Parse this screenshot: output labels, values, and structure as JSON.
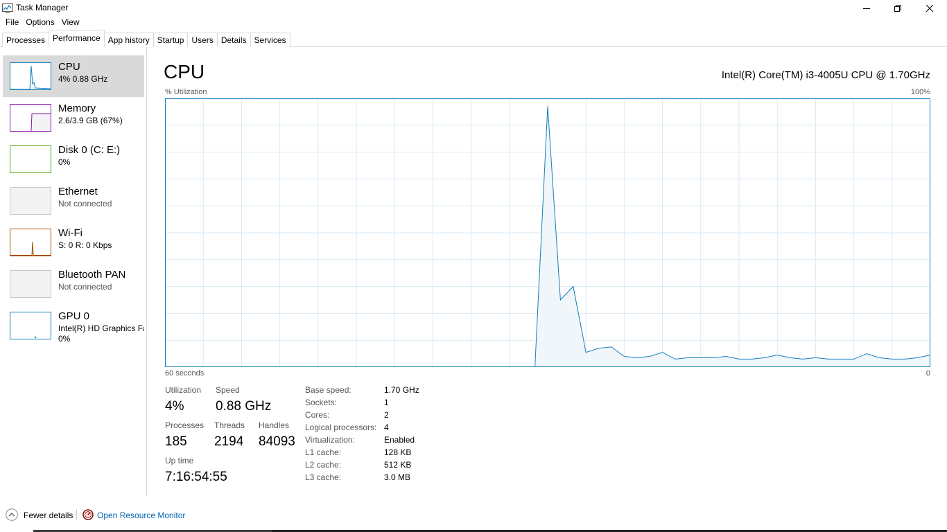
{
  "window": {
    "title": "Task Manager",
    "icon": "task-manager-icon",
    "controls": [
      "minimize-icon",
      "restore-icon",
      "close-icon"
    ]
  },
  "menu": {
    "file": "File",
    "options": "Options",
    "view": "View"
  },
  "tabs": [
    {
      "label": "Processes",
      "active": false
    },
    {
      "label": "Performance",
      "active": true
    },
    {
      "label": "App history",
      "active": false
    },
    {
      "label": "Startup",
      "active": false
    },
    {
      "label": "Users",
      "active": false
    },
    {
      "label": "Details",
      "active": false
    },
    {
      "label": "Services",
      "active": false
    }
  ],
  "sidebar": {
    "items": [
      {
        "name": "CPU",
        "sub": "4%  0.88 GHz",
        "color": "#117dbb",
        "selected": true
      },
      {
        "name": "Memory",
        "sub": "2.6/3.9 GB (67%)",
        "color": "#8b12ae",
        "selected": false
      },
      {
        "name": "Disk 0 (C: E:)",
        "sub": "0%",
        "color": "#4da60c",
        "selected": false
      },
      {
        "name": "Ethernet",
        "sub": "Not connected",
        "color": "#c7c7c7",
        "selected": false
      },
      {
        "name": "Wi-Fi",
        "sub": "S: 0  R: 0 Kbps",
        "color": "#a74f01",
        "selected": false
      },
      {
        "name": "Bluetooth PAN",
        "sub": "Not connected",
        "color": "#c7c7c7",
        "selected": false
      },
      {
        "name": "GPU 0",
        "sub": "Intel(R) HD Graphics Family",
        "sub2": "0%",
        "color": "#117dbb",
        "selected": false
      }
    ]
  },
  "main": {
    "title": "CPU",
    "model": "Intel(R) Core(TM) i3-4005U CPU @ 1.70GHz",
    "graph_label": "% Utilization",
    "graph_max": "100%",
    "graph_time": "60 seconds",
    "graph_min": "0"
  },
  "chart_data": {
    "type": "area",
    "x": [
      0,
      1,
      2,
      3,
      4,
      5,
      6,
      7,
      8,
      9,
      10,
      11,
      12,
      13,
      14,
      15,
      16,
      17,
      18,
      19,
      20,
      21,
      22,
      23,
      24,
      25,
      26,
      27,
      28,
      29,
      30,
      31,
      32,
      33,
      34,
      35,
      36,
      37,
      38,
      39,
      40,
      41,
      42,
      43,
      44,
      45,
      46,
      47,
      48,
      49,
      50,
      51,
      52,
      53,
      54,
      55,
      56,
      57,
      58,
      59,
      60
    ],
    "values": [
      0,
      0,
      0,
      0,
      0,
      0,
      0,
      0,
      0,
      0,
      0,
      0,
      0,
      0,
      0,
      0,
      0,
      0,
      0,
      0,
      0,
      0,
      0,
      0,
      0,
      0,
      0,
      0,
      0,
      0,
      97,
      25,
      30,
      5.5,
      7,
      7.5,
      4,
      3.5,
      4,
      5.5,
      3,
      3.5,
      3.5,
      3.5,
      4,
      3,
      3,
      3.5,
      4.5,
      3.5,
      3,
      3.5,
      3,
      3,
      3,
      5,
      3.5,
      3,
      3,
      3.5,
      4.5
    ],
    "xlim": [
      0,
      60
    ],
    "ylim": [
      0,
      100
    ],
    "grid": true,
    "color": "#117dbb",
    "fill": "#f1f6fa"
  },
  "stats": {
    "utilization_label": "Utilization",
    "utilization": "4%",
    "speed_label": "Speed",
    "speed": "0.88 GHz",
    "processes_label": "Processes",
    "processes": "185",
    "threads_label": "Threads",
    "threads": "2194",
    "handles_label": "Handles",
    "handles": "84093",
    "uptime_label": "Up time",
    "uptime": "7:16:54:55"
  },
  "specs": [
    {
      "label": "Base speed:",
      "value": "1.70 GHz"
    },
    {
      "label": "Sockets:",
      "value": "1"
    },
    {
      "label": "Cores:",
      "value": "2"
    },
    {
      "label": "Logical processors:",
      "value": "4"
    },
    {
      "label": "Virtualization:",
      "value": "Enabled"
    },
    {
      "label": "L1 cache:",
      "value": "128 KB"
    },
    {
      "label": "L2 cache:",
      "value": "512 KB"
    },
    {
      "label": "L3 cache:",
      "value": "3.0 MB"
    }
  ],
  "footer": {
    "fewer_details": "Fewer details",
    "resource_monitor": "Open Resource Monitor"
  }
}
